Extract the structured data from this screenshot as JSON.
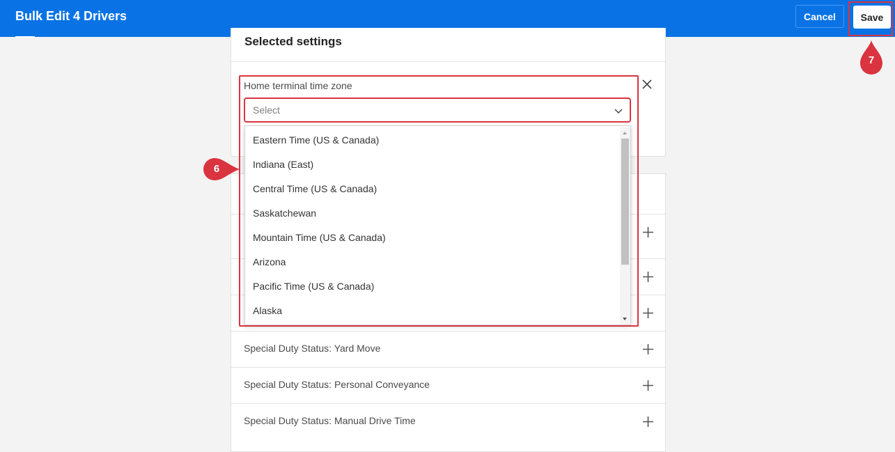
{
  "header": {
    "title": "Bulk Edit 4 Drivers",
    "cancel_label": "Cancel",
    "save_label": "Save",
    "bg_color": "#0973e5"
  },
  "selected_settings": {
    "heading": "Selected settings",
    "field": {
      "label": "Home terminal time zone",
      "placeholder": "Select"
    },
    "dropdown_options": [
      "Eastern Time (US & Canada)",
      "Indiana (East)",
      "Central Time (US & Canada)",
      "Saskatchewan",
      "Mountain Time (US & Canada)",
      "Arizona",
      "Pacific Time (US & Canada)",
      "Alaska"
    ]
  },
  "available_settings": [
    "Special Duty Status: Yard Move",
    "Special Duty Status: Personal Conveyance",
    "Special Duty Status: Manual Drive Time"
  ],
  "callouts": {
    "step_6": "6",
    "step_7": "7",
    "color": "#d9343f"
  }
}
